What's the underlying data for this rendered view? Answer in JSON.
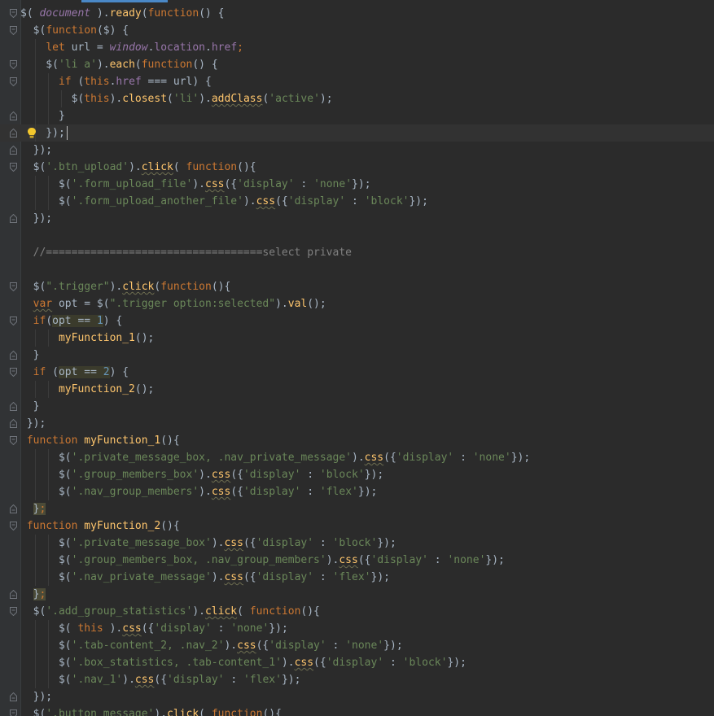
{
  "editor": {
    "language": "javascript",
    "current_line_index": 7,
    "lines": [
      [
        {
          "t": "$( ",
          "c": "pl"
        },
        {
          "t": "document",
          "c": "glob"
        },
        {
          "t": " ).",
          "c": "pl"
        },
        {
          "t": "ready",
          "c": "fn"
        },
        {
          "t": "(",
          "c": "pl"
        },
        {
          "t": "function",
          "c": "kw"
        },
        {
          "t": "() {",
          "c": "pl"
        }
      ],
      [
        {
          "t": "  $(",
          "c": "pl"
        },
        {
          "t": "function",
          "c": "kw"
        },
        {
          "t": "($) {",
          "c": "pl"
        }
      ],
      [
        {
          "t": "    ",
          "c": "pl"
        },
        {
          "t": "let",
          "c": "kw"
        },
        {
          "t": " url = ",
          "c": "pl"
        },
        {
          "t": "window",
          "c": "glob"
        },
        {
          "t": ".",
          "c": "pl"
        },
        {
          "t": "location",
          "c": "prop"
        },
        {
          "t": ".",
          "c": "pl"
        },
        {
          "t": "href",
          "c": "prop"
        },
        {
          "t": ";",
          "c": "kw"
        }
      ],
      [
        {
          "t": "    $(",
          "c": "pl"
        },
        {
          "t": "'li a'",
          "c": "str"
        },
        {
          "t": ").",
          "c": "pl"
        },
        {
          "t": "each",
          "c": "fn"
        },
        {
          "t": "(",
          "c": "pl"
        },
        {
          "t": "function",
          "c": "kw"
        },
        {
          "t": "() {",
          "c": "pl"
        }
      ],
      [
        {
          "t": "      ",
          "c": "pl"
        },
        {
          "t": "if",
          "c": "kw"
        },
        {
          "t": " (",
          "c": "pl"
        },
        {
          "t": "this",
          "c": "kw"
        },
        {
          "t": ".",
          "c": "pl"
        },
        {
          "t": "href",
          "c": "prop"
        },
        {
          "t": " === url) {",
          "c": "pl"
        }
      ],
      [
        {
          "t": "        $(",
          "c": "pl"
        },
        {
          "t": "this",
          "c": "kw"
        },
        {
          "t": ").",
          "c": "pl"
        },
        {
          "t": "closest",
          "c": "fn"
        },
        {
          "t": "(",
          "c": "pl"
        },
        {
          "t": "'li'",
          "c": "str"
        },
        {
          "t": ").",
          "c": "pl"
        },
        {
          "t": "addClass",
          "c": "fn wv"
        },
        {
          "t": "(",
          "c": "pl"
        },
        {
          "t": "'active'",
          "c": "str"
        },
        {
          "t": ");",
          "c": "pl"
        }
      ],
      [
        {
          "t": "      }",
          "c": "pl"
        }
      ],
      [
        {
          "t": "    });",
          "c": "pl"
        }
      ],
      [
        {
          "t": "  });",
          "c": "pl"
        }
      ],
      [
        {
          "t": "  $(",
          "c": "pl"
        },
        {
          "t": "'.btn_upload'",
          "c": "str"
        },
        {
          "t": ").",
          "c": "pl"
        },
        {
          "t": "click",
          "c": "fn wv"
        },
        {
          "t": "( ",
          "c": "pl"
        },
        {
          "t": "function",
          "c": "kw"
        },
        {
          "t": "(){",
          "c": "pl"
        }
      ],
      [
        {
          "t": "      $(",
          "c": "pl"
        },
        {
          "t": "'.form_upload_file'",
          "c": "str"
        },
        {
          "t": ").",
          "c": "pl"
        },
        {
          "t": "css",
          "c": "fn wv"
        },
        {
          "t": "({",
          "c": "pl"
        },
        {
          "t": "'display'",
          "c": "str"
        },
        {
          "t": " : ",
          "c": "pl"
        },
        {
          "t": "'none'",
          "c": "str"
        },
        {
          "t": "});",
          "c": "pl"
        }
      ],
      [
        {
          "t": "      $(",
          "c": "pl"
        },
        {
          "t": "'.form_upload_another_file'",
          "c": "str"
        },
        {
          "t": ").",
          "c": "pl"
        },
        {
          "t": "css",
          "c": "fn wv"
        },
        {
          "t": "({",
          "c": "pl"
        },
        {
          "t": "'display'",
          "c": "str"
        },
        {
          "t": " : ",
          "c": "pl"
        },
        {
          "t": "'block'",
          "c": "str"
        },
        {
          "t": "});",
          "c": "pl"
        }
      ],
      [
        {
          "t": "  });",
          "c": "pl"
        }
      ],
      [],
      [
        {
          "t": "  //==================================select private",
          "c": "cm"
        }
      ],
      [],
      [
        {
          "t": "  $(",
          "c": "pl"
        },
        {
          "t": "\".trigger\"",
          "c": "str"
        },
        {
          "t": ").",
          "c": "pl"
        },
        {
          "t": "click",
          "c": "fn wv"
        },
        {
          "t": "(",
          "c": "pl"
        },
        {
          "t": "function",
          "c": "kw"
        },
        {
          "t": "(){",
          "c": "pl"
        }
      ],
      [
        {
          "t": "  ",
          "c": "pl"
        },
        {
          "t": "var",
          "c": "kw wv"
        },
        {
          "t": " opt = $(",
          "c": "pl"
        },
        {
          "t": "\".trigger option:selected\"",
          "c": "str"
        },
        {
          "t": ").",
          "c": "pl"
        },
        {
          "t": "val",
          "c": "fn"
        },
        {
          "t": "();",
          "c": "pl"
        }
      ],
      [
        {
          "t": "  ",
          "c": "pl"
        },
        {
          "t": "if",
          "c": "kw"
        },
        {
          "t": "(",
          "c": "pl"
        },
        {
          "t": "opt == ",
          "c": "pl hl"
        },
        {
          "t": "1",
          "c": "num hl"
        },
        {
          "t": ") {",
          "c": "pl"
        }
      ],
      [
        {
          "t": "      ",
          "c": "pl"
        },
        {
          "t": "myFunction_1",
          "c": "fn"
        },
        {
          "t": "();",
          "c": "pl"
        }
      ],
      [
        {
          "t": "  }",
          "c": "pl"
        }
      ],
      [
        {
          "t": "  ",
          "c": "pl"
        },
        {
          "t": "if",
          "c": "kw"
        },
        {
          "t": " (",
          "c": "pl"
        },
        {
          "t": "opt == ",
          "c": "pl hl"
        },
        {
          "t": "2",
          "c": "num hl"
        },
        {
          "t": ") {",
          "c": "pl"
        }
      ],
      [
        {
          "t": "      ",
          "c": "pl"
        },
        {
          "t": "myFunction_2",
          "c": "fn"
        },
        {
          "t": "();",
          "c": "pl"
        }
      ],
      [
        {
          "t": "  }",
          "c": "pl"
        }
      ],
      [
        {
          "t": " });",
          "c": "pl"
        }
      ],
      [
        {
          "t": " ",
          "c": "pl"
        },
        {
          "t": "function",
          "c": "kw"
        },
        {
          "t": " ",
          "c": "pl"
        },
        {
          "t": "myFunction_1",
          "c": "fn"
        },
        {
          "t": "(){",
          "c": "pl"
        }
      ],
      [
        {
          "t": "      $(",
          "c": "pl"
        },
        {
          "t": "'.private_message_box, .nav_private_message'",
          "c": "str"
        },
        {
          "t": ").",
          "c": "pl"
        },
        {
          "t": "css",
          "c": "fn wv"
        },
        {
          "t": "({",
          "c": "pl"
        },
        {
          "t": "'display'",
          "c": "str"
        },
        {
          "t": " : ",
          "c": "pl"
        },
        {
          "t": "'none'",
          "c": "str"
        },
        {
          "t": "});",
          "c": "pl"
        }
      ],
      [
        {
          "t": "      $(",
          "c": "pl"
        },
        {
          "t": "'.group_members_box'",
          "c": "str"
        },
        {
          "t": ").",
          "c": "pl"
        },
        {
          "t": "css",
          "c": "fn wv"
        },
        {
          "t": "({",
          "c": "pl"
        },
        {
          "t": "'display'",
          "c": "str"
        },
        {
          "t": " : ",
          "c": "pl"
        },
        {
          "t": "'block'",
          "c": "str"
        },
        {
          "t": "});",
          "c": "pl"
        }
      ],
      [
        {
          "t": "      $(",
          "c": "pl"
        },
        {
          "t": "'.nav_group_members'",
          "c": "str"
        },
        {
          "t": ").",
          "c": "pl"
        },
        {
          "t": "css",
          "c": "fn wv"
        },
        {
          "t": "({",
          "c": "pl"
        },
        {
          "t": "'display'",
          "c": "str"
        },
        {
          "t": " : ",
          "c": "pl"
        },
        {
          "t": "'flex'",
          "c": "str"
        },
        {
          "t": "});",
          "c": "pl"
        }
      ],
      [
        {
          "t": "  ",
          "c": "pl"
        },
        {
          "t": "}",
          "c": "pl hlb"
        },
        {
          "t": ";",
          "c": "kw hlb"
        }
      ],
      [
        {
          "t": " ",
          "c": "pl"
        },
        {
          "t": "function",
          "c": "kw"
        },
        {
          "t": " ",
          "c": "pl"
        },
        {
          "t": "myFunction_2",
          "c": "fn"
        },
        {
          "t": "(){",
          "c": "pl"
        }
      ],
      [
        {
          "t": "      $(",
          "c": "pl"
        },
        {
          "t": "'.private_message_box'",
          "c": "str"
        },
        {
          "t": ").",
          "c": "pl"
        },
        {
          "t": "css",
          "c": "fn wv"
        },
        {
          "t": "({",
          "c": "pl"
        },
        {
          "t": "'display'",
          "c": "str"
        },
        {
          "t": " : ",
          "c": "pl"
        },
        {
          "t": "'block'",
          "c": "str"
        },
        {
          "t": "});",
          "c": "pl"
        }
      ],
      [
        {
          "t": "      $(",
          "c": "pl"
        },
        {
          "t": "'.group_members_box, .nav_group_members'",
          "c": "str"
        },
        {
          "t": ").",
          "c": "pl"
        },
        {
          "t": "css",
          "c": "fn wv"
        },
        {
          "t": "({",
          "c": "pl"
        },
        {
          "t": "'display'",
          "c": "str"
        },
        {
          "t": " : ",
          "c": "pl"
        },
        {
          "t": "'none'",
          "c": "str"
        },
        {
          "t": "});",
          "c": "pl"
        }
      ],
      [
        {
          "t": "      $(",
          "c": "pl"
        },
        {
          "t": "'.nav_private_message'",
          "c": "str"
        },
        {
          "t": ").",
          "c": "pl"
        },
        {
          "t": "css",
          "c": "fn wv"
        },
        {
          "t": "({",
          "c": "pl"
        },
        {
          "t": "'display'",
          "c": "str"
        },
        {
          "t": " : ",
          "c": "pl"
        },
        {
          "t": "'flex'",
          "c": "str"
        },
        {
          "t": "});",
          "c": "pl"
        }
      ],
      [
        {
          "t": "  ",
          "c": "pl"
        },
        {
          "t": "}",
          "c": "pl hlb"
        },
        {
          "t": ";",
          "c": "kw hlb"
        }
      ],
      [
        {
          "t": "  $(",
          "c": "pl"
        },
        {
          "t": "'.add_group_statistics'",
          "c": "str"
        },
        {
          "t": ").",
          "c": "pl"
        },
        {
          "t": "click",
          "c": "fn wv"
        },
        {
          "t": "( ",
          "c": "pl"
        },
        {
          "t": "function",
          "c": "kw"
        },
        {
          "t": "(){",
          "c": "pl"
        }
      ],
      [
        {
          "t": "      $( ",
          "c": "pl"
        },
        {
          "t": "this",
          "c": "kw"
        },
        {
          "t": " ).",
          "c": "pl"
        },
        {
          "t": "css",
          "c": "fn wv"
        },
        {
          "t": "({",
          "c": "pl"
        },
        {
          "t": "'display'",
          "c": "str"
        },
        {
          "t": " : ",
          "c": "pl"
        },
        {
          "t": "'none'",
          "c": "str"
        },
        {
          "t": "});",
          "c": "pl"
        }
      ],
      [
        {
          "t": "      $(",
          "c": "pl"
        },
        {
          "t": "'.tab-content_2, .nav_2'",
          "c": "str"
        },
        {
          "t": ").",
          "c": "pl"
        },
        {
          "t": "css",
          "c": "fn wv"
        },
        {
          "t": "({",
          "c": "pl"
        },
        {
          "t": "'display'",
          "c": "str"
        },
        {
          "t": " : ",
          "c": "pl"
        },
        {
          "t": "'none'",
          "c": "str"
        },
        {
          "t": "});",
          "c": "pl"
        }
      ],
      [
        {
          "t": "      $(",
          "c": "pl"
        },
        {
          "t": "'.box_statistics, .tab-content_1'",
          "c": "str"
        },
        {
          "t": ").",
          "c": "pl"
        },
        {
          "t": "css",
          "c": "fn wv"
        },
        {
          "t": "({",
          "c": "pl"
        },
        {
          "t": "'display'",
          "c": "str"
        },
        {
          "t": " : ",
          "c": "pl"
        },
        {
          "t": "'block'",
          "c": "str"
        },
        {
          "t": "});",
          "c": "pl"
        }
      ],
      [
        {
          "t": "      $(",
          "c": "pl"
        },
        {
          "t": "'.nav_1'",
          "c": "str"
        },
        {
          "t": ").",
          "c": "pl"
        },
        {
          "t": "css",
          "c": "fn wv"
        },
        {
          "t": "({",
          "c": "pl"
        },
        {
          "t": "'display'",
          "c": "str"
        },
        {
          "t": " : ",
          "c": "pl"
        },
        {
          "t": "'flex'",
          "c": "str"
        },
        {
          "t": "});",
          "c": "pl"
        }
      ],
      [
        {
          "t": "  });",
          "c": "pl"
        }
      ],
      [
        {
          "t": "  $(",
          "c": "pl"
        },
        {
          "t": "'.button_message'",
          "c": "str"
        },
        {
          "t": ").",
          "c": "pl"
        },
        {
          "t": "click",
          "c": "fn wv"
        },
        {
          "t": "( ",
          "c": "pl"
        },
        {
          "t": "function",
          "c": "kw"
        },
        {
          "t": "(){",
          "c": "pl"
        }
      ]
    ],
    "fold_markers": [
      {
        "line": 0,
        "type": "open"
      },
      {
        "line": 1,
        "type": "open"
      },
      {
        "line": 3,
        "type": "open"
      },
      {
        "line": 4,
        "type": "open"
      },
      {
        "line": 6,
        "type": "close"
      },
      {
        "line": 7,
        "type": "close"
      },
      {
        "line": 8,
        "type": "close"
      },
      {
        "line": 9,
        "type": "open"
      },
      {
        "line": 12,
        "type": "close"
      },
      {
        "line": 16,
        "type": "open"
      },
      {
        "line": 18,
        "type": "open"
      },
      {
        "line": 20,
        "type": "close"
      },
      {
        "line": 21,
        "type": "open"
      },
      {
        "line": 23,
        "type": "close"
      },
      {
        "line": 24,
        "type": "close"
      },
      {
        "line": 25,
        "type": "open"
      },
      {
        "line": 29,
        "type": "close"
      },
      {
        "line": 30,
        "type": "open"
      },
      {
        "line": 34,
        "type": "close"
      },
      {
        "line": 35,
        "type": "open"
      },
      {
        "line": 40,
        "type": "close"
      },
      {
        "line": 41,
        "type": "open"
      }
    ],
    "intention_bulb_line": 7
  }
}
